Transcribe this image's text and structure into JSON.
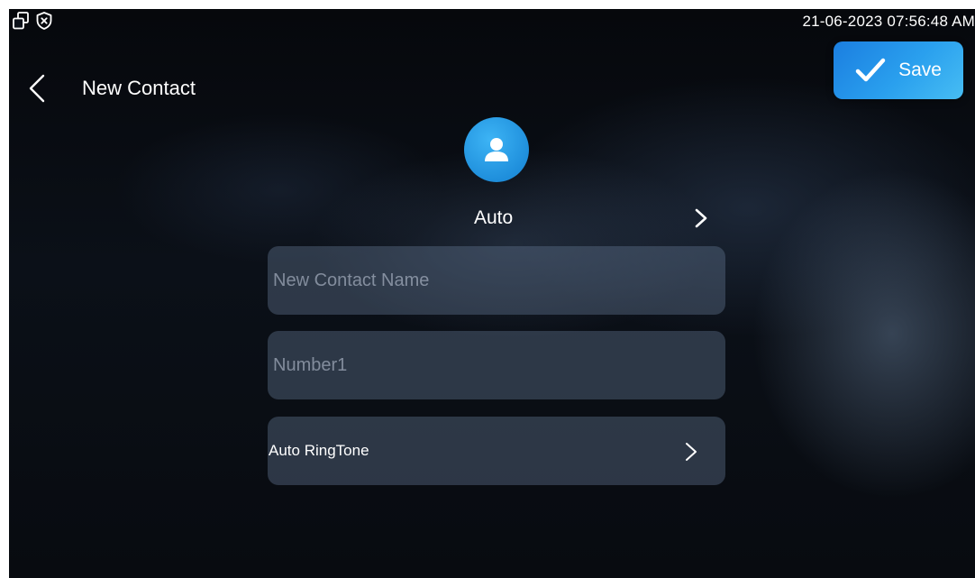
{
  "status_bar": {
    "datetime": "21-06-2023 07:56:48 AM",
    "icons": [
      "windows-icon",
      "shield-close-icon"
    ]
  },
  "header": {
    "title": "New Contact",
    "back_icon": "chevron-left-icon",
    "save_label": "Save",
    "save_icon": "checkmark-icon"
  },
  "avatar": {
    "icon": "person-icon",
    "label": "Auto",
    "chevron_icon": "chevron-right-icon"
  },
  "form": {
    "name_placeholder": "New Contact Name",
    "name_value": "",
    "number_placeholder": "Number1",
    "number_value": "",
    "ringtone_label": "Auto RingTone",
    "ringtone_chevron_icon": "chevron-right-icon"
  },
  "colors": {
    "accent": "#2aa0ee",
    "background": "#0b1018",
    "field_background": "#3a4a5e"
  }
}
